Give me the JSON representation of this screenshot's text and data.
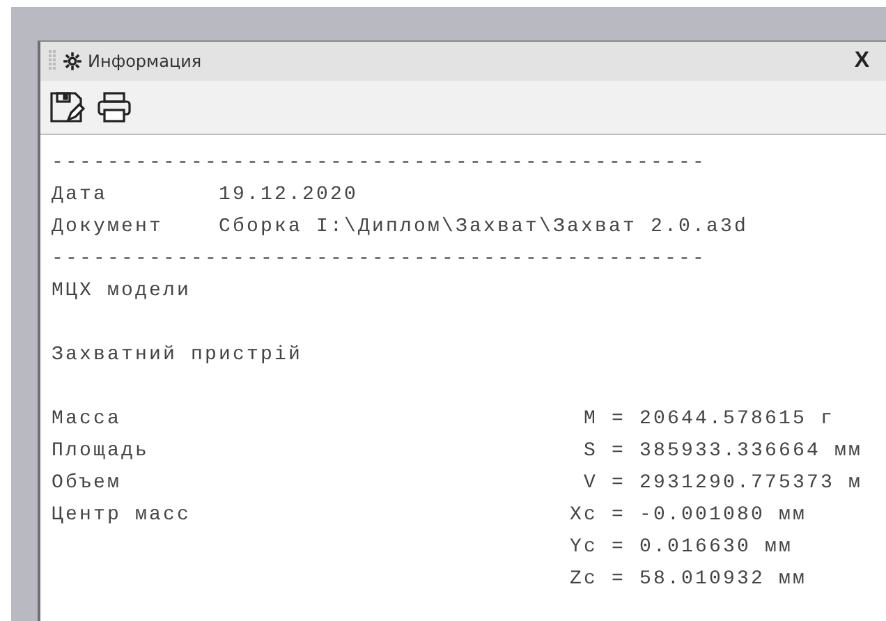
{
  "window": {
    "title": "Информация",
    "close": "X"
  },
  "lines": [
    {
      "kind": "rule",
      "text": "-----------------------------------------------"
    },
    {
      "kind": "field",
      "label": "Дата",
      "value": "19.12.2020"
    },
    {
      "kind": "field",
      "label": "Документ",
      "value": "Сборка I:\\Диплом\\Захват\\Захват 2.0.a3d"
    },
    {
      "kind": "rule",
      "text": "-----------------------------------------------"
    },
    {
      "kind": "text",
      "text": "МЦХ модели"
    },
    {
      "kind": "blank"
    },
    {
      "kind": "text",
      "text": "Захватний пристрій"
    },
    {
      "kind": "blank"
    },
    {
      "kind": "param",
      "label": "Масса",
      "symbol": "M",
      "value": "= 20644.578615 г"
    },
    {
      "kind": "param",
      "label": "Площадь",
      "symbol": "S",
      "value": "= 385933.336664 мм"
    },
    {
      "kind": "param",
      "label": "Объем",
      "symbol": "V",
      "value": "= 2931290.775373 м"
    },
    {
      "kind": "param",
      "label": "Центр масс",
      "symbol": "Xc",
      "value": "= -0.001080 мм"
    },
    {
      "kind": "param",
      "symbol": "Yc",
      "value": "= 0.016630 мм"
    },
    {
      "kind": "param",
      "symbol": "Zc",
      "value": "= 58.010932 мм"
    }
  ]
}
